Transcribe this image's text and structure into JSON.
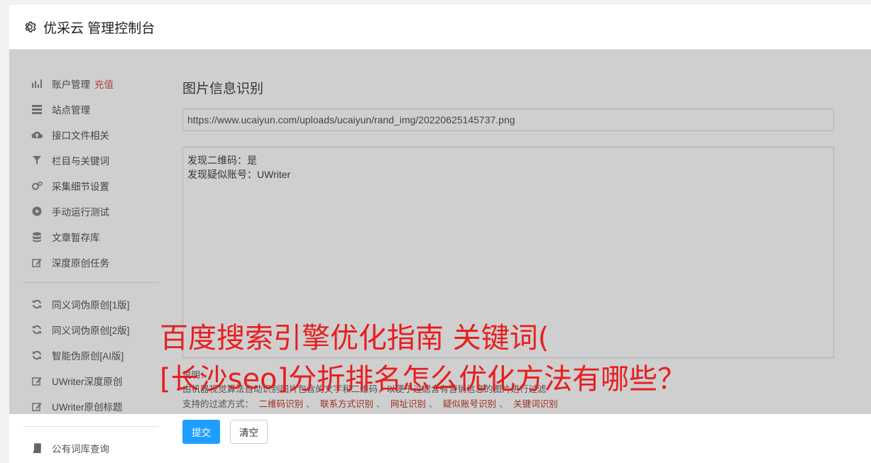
{
  "header": {
    "title": "优采云 管理控制台",
    "icon": "gear-icon"
  },
  "sidebar": {
    "items": [
      {
        "label": "账户管理",
        "badge": "充值",
        "icon": "bar-chart-icon"
      },
      {
        "label": "站点管理",
        "icon": "server-icon"
      },
      {
        "label": "接口文件相关",
        "icon": "cloud-upload-icon"
      },
      {
        "label": "栏目与关键词",
        "icon": "filter-icon"
      },
      {
        "label": "采集细节设置",
        "icon": "cogs-icon"
      },
      {
        "label": "手动运行测试",
        "icon": "play-circle-icon"
      },
      {
        "label": "文章暂存库",
        "icon": "database-icon"
      },
      {
        "label": "深度原创任务",
        "icon": "edit-icon"
      }
    ],
    "items2": [
      {
        "label": "同义词伪原创[1版]",
        "icon": "refresh-icon"
      },
      {
        "label": "同义词伪原创[2版]",
        "icon": "refresh-icon"
      },
      {
        "label": "智能伪原创[AI版]",
        "icon": "refresh-icon"
      },
      {
        "label": "UWriter深度原创",
        "icon": "edit-icon"
      },
      {
        "label": "UWriter原创标题",
        "icon": "edit-icon"
      }
    ],
    "items3": [
      {
        "label": "公有词库查询",
        "icon": "book-icon"
      }
    ]
  },
  "main": {
    "title": "图片信息识别",
    "url_value": "https://www.ucaiyun.com/uploads/ucaiyun/rand_img/20220625145737.png",
    "result_lines": [
      "发现二维码：是",
      "发现疑似账号：UWriter"
    ],
    "desc_label": "说明：",
    "desc_text": "由机器视觉算法自动识别图片包含的文字和二维码，以便于过滤含有营销信息的图片进行过滤",
    "filters_label": "支持的过滤方式：",
    "filters": [
      "二维码识别",
      "联系方式识别",
      "网址识别",
      "疑似账号识别",
      "关键词识别"
    ],
    "filter_sep": "、",
    "submit_label": "提交",
    "clear_label": "清空"
  },
  "watermark": {
    "line1": "百度搜索引擎优化指南 关键词(",
    "line2": "[长沙seo]分折排名怎么优化方法有哪些？"
  },
  "colors": {
    "accent": "#1e9fff",
    "badge": "#d9534f",
    "watermark": "#e81e1e"
  }
}
